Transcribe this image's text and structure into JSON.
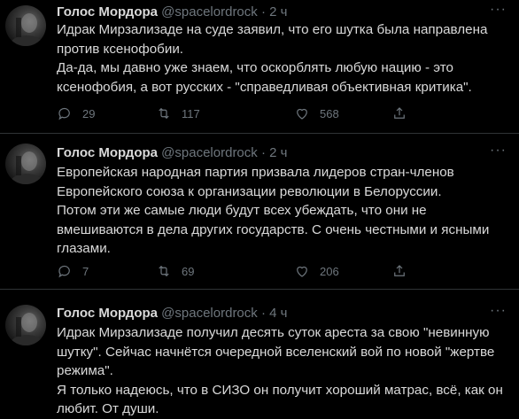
{
  "tweets": [
    {
      "name": "Голос Мордора",
      "handle": "@spacelordrock",
      "sep": "·",
      "time": "2 ч",
      "lines": [
        "Идрак Мирзализаде на суде заявил, что его шутка была направлена",
        "против ксенофобии.",
        "Да-да, мы давно уже знаем, что оскорблять любую нацию - это",
        "ксенофобия, а вот русских - \"справедливая объективная критика\"."
      ],
      "replies": "29",
      "retweets": "117",
      "likes": "568"
    },
    {
      "name": "Голос Мордора",
      "handle": "@spacelordrock",
      "sep": "·",
      "time": "2 ч",
      "lines": [
        "Европейская народная партия призвала лидеров стран-членов",
        "Европейского союза к организации революции в Белоруссии.",
        "Потом эти же самые люди будут всех убеждать, что они не",
        "вмешиваются в дела других государств. С очень честными и ясными",
        "глазами."
      ],
      "replies": "7",
      "retweets": "69",
      "likes": "206"
    },
    {
      "name": "Голос Мордора",
      "handle": "@spacelordrock",
      "sep": "·",
      "time": "4 ч",
      "lines": [
        "Идрак Мирзализаде получил десять суток ареста за свою \"невинную",
        "шутку\". Сейчас начнётся очередной вселенский вой по новой \"жертве",
        "режима\".",
        "Я только надеюсь, что в СИЗО он получит хороший матрас, всё, как он",
        "любит. От души."
      ]
    }
  ],
  "icons": {
    "avatar": "avatar-photo",
    "more": "more-horizontal-icon",
    "reply": "reply-bubble-icon",
    "retweet": "retweet-arrows-icon",
    "like": "heart-icon",
    "share": "share-upload-icon"
  },
  "colors": {
    "background": "#000000",
    "text": "#d9d9d9",
    "muted": "#6e767d",
    "divider": "#2f3336"
  }
}
